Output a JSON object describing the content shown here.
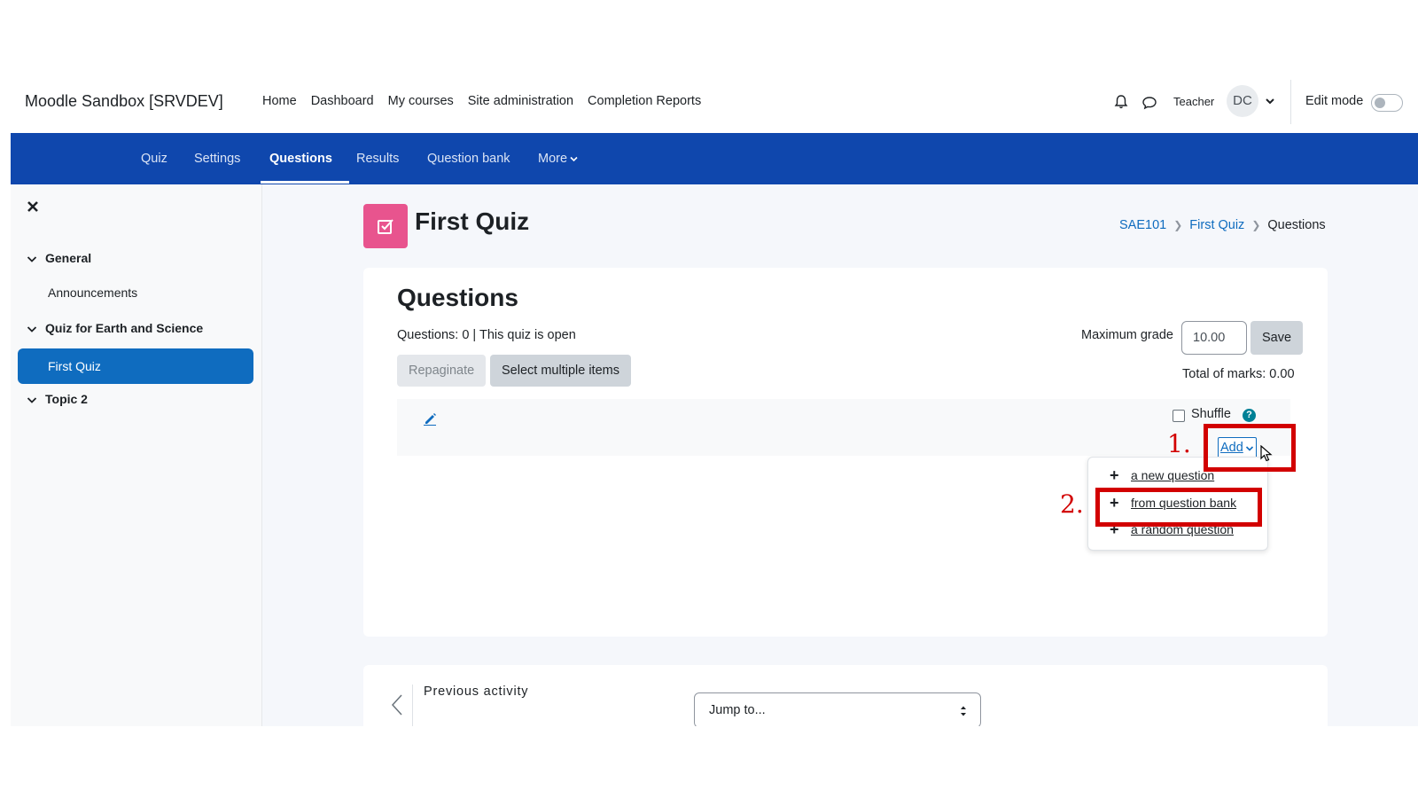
{
  "topbar": {
    "brand": "Moodle Sandbox [SRVDEV]",
    "nav": [
      "Home",
      "Dashboard",
      "My courses",
      "Site administration",
      "Completion Reports"
    ],
    "user_name": "Teacher",
    "avatar_initials": "DC",
    "edit_mode_label": "Edit mode",
    "edit_mode_on": false
  },
  "secondary_nav": {
    "tabs": [
      "Quiz",
      "Settings",
      "Questions",
      "Results",
      "Question bank",
      "More"
    ],
    "active": "Questions"
  },
  "drawer": {
    "sections": [
      {
        "label": "General",
        "items": [
          "Announcements"
        ]
      },
      {
        "label": "Quiz for Earth and Science",
        "items": [
          "First Quiz"
        ]
      },
      {
        "label": "Topic 2",
        "items": []
      }
    ],
    "current_item": "First Quiz"
  },
  "header": {
    "title": "First Quiz",
    "breadcrumb": [
      "SAE101",
      "First Quiz",
      "Questions"
    ]
  },
  "questions_panel": {
    "heading": "Questions",
    "info": "Questions: 0 | This quiz is open",
    "repaginate_label": "Repaginate",
    "select_multiple_label": "Select multiple items",
    "max_grade_label": "Maximum grade",
    "max_grade_value": "10.00",
    "save_label": "Save",
    "total_marks": "Total of marks: 0.00",
    "shuffle_label": "Shuffle",
    "shuffle_checked": false,
    "help_glyph": "?",
    "add_label": "Add"
  },
  "add_menu": {
    "items": [
      "a new question",
      "from question bank",
      "a random question"
    ],
    "plus_glyph": "+"
  },
  "annotations": {
    "step1": "1.",
    "step2": "2.",
    "color": "#d20000"
  },
  "activity_nav": {
    "previous_label": "Previous activity",
    "jump_placeholder": "Jump to..."
  },
  "colors": {
    "secondary_nav_bg": "#0f47ad",
    "drawer_current_bg": "#0f6cbf",
    "link": "#0f6cbf",
    "quiz_icon_bg": "#e8548e"
  },
  "icons": [
    "bell-icon",
    "chat-icon",
    "chevron-down-icon",
    "close-icon",
    "quiz-icon",
    "pencil-icon",
    "help-icon",
    "plus-icon",
    "mouse-cursor-icon",
    "chevron-left-icon",
    "sort-arrows-icon"
  ]
}
